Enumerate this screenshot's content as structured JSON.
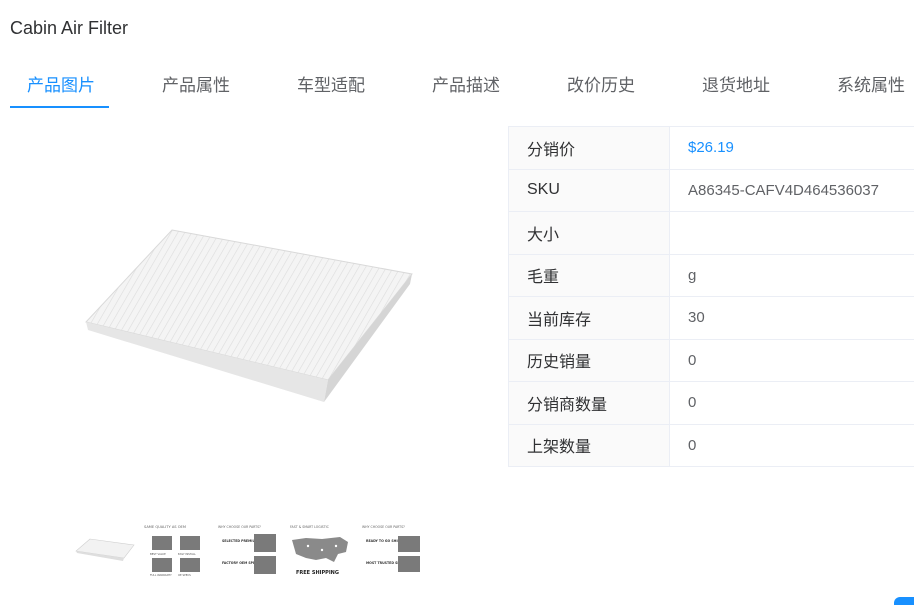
{
  "page": {
    "title": "Cabin Air Filter"
  },
  "tabs": [
    {
      "label": "产品图片",
      "active": true
    },
    {
      "label": "产品属性"
    },
    {
      "label": "车型适配"
    },
    {
      "label": "产品描述"
    },
    {
      "label": "改价历史"
    },
    {
      "label": "退货地址"
    },
    {
      "label": "系统属性"
    }
  ],
  "specs": [
    {
      "key": "分销价",
      "value": "$26.19"
    },
    {
      "key": "SKU",
      "value": "A86345-CAFV4D464536037"
    },
    {
      "key": "大小",
      "value": ""
    },
    {
      "key": "毛重",
      "value": "g"
    },
    {
      "key": "当前库存",
      "value": "30"
    },
    {
      "key": "历史销量",
      "value": "0"
    },
    {
      "key": "分销商数量",
      "value": "0"
    },
    {
      "key": "上架数量",
      "value": "0"
    }
  ],
  "thumbnails": {
    "t2_header": "SAME QUALITY AS OEM",
    "t2_labels": [
      "BEST VALUE",
      "EASY INSTALL",
      "FULL WARRANTY",
      "OE SPECS"
    ],
    "t3_header": "WHY CHOOSE OUR PARTS?",
    "t3_labels": [
      "SELECTED PREMIUM QUALITY",
      "FACTORY OEM SPECS"
    ],
    "t4_header": "FAST & SMART LOGISTIC",
    "t4_caption": "FREE SHIPPING",
    "t5_header": "WHY CHOOSE OUR PARTS?",
    "t5_labels": [
      "READY TO GO SHIPPING",
      "MOST TRUSTED SELLER"
    ]
  },
  "colors": {
    "accent": "#1890ff"
  }
}
